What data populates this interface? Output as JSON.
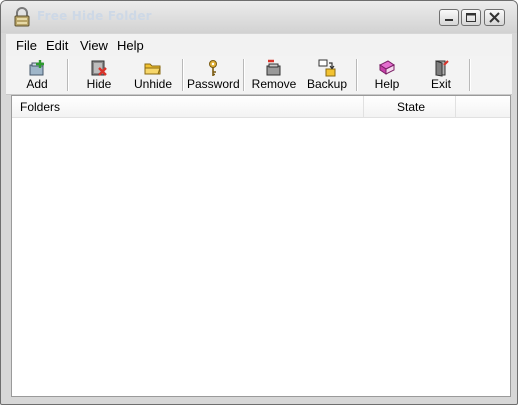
{
  "window": {
    "title": "Free Hide Folder"
  },
  "menu": {
    "items": [
      "File",
      "Edit",
      "View",
      "Help"
    ]
  },
  "toolbar": {
    "buttons": [
      {
        "label": "Add",
        "icon": "add-icon"
      },
      {
        "label": "Hide",
        "icon": "hide-icon"
      },
      {
        "label": "Unhide",
        "icon": "unhide-icon"
      },
      {
        "label": "Password",
        "icon": "key-icon"
      },
      {
        "label": "Remove",
        "icon": "remove-icon"
      },
      {
        "label": "Backup",
        "icon": "backup-icon"
      },
      {
        "label": "Help",
        "icon": "help-book-icon"
      },
      {
        "label": "Exit",
        "icon": "exit-door-icon"
      }
    ]
  },
  "list": {
    "columns": [
      "Folders",
      "State"
    ],
    "rows": []
  },
  "colors": {
    "accent_green": "#2e9b2e",
    "folder_yellow": "#f2c230",
    "delete_red": "#d9342b",
    "help_magenta": "#c63fa8"
  }
}
